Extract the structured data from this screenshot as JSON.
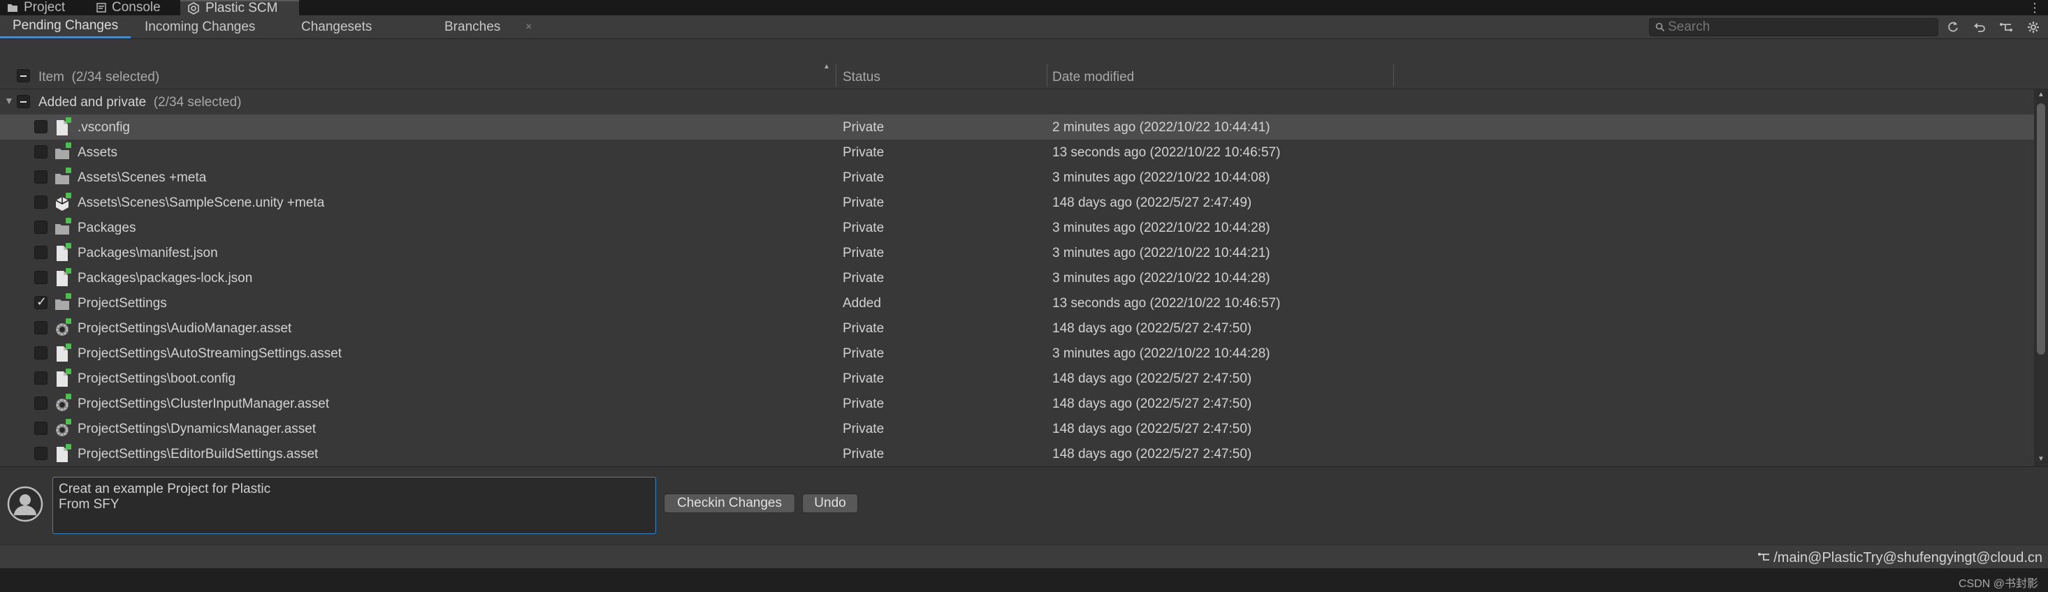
{
  "window_tabs": [
    {
      "label": "Project",
      "icon": "folder-icon"
    },
    {
      "label": "Console",
      "icon": "console-icon"
    },
    {
      "label": "Plastic SCM",
      "icon": "plastic-scm-icon"
    }
  ],
  "toolbar": {
    "tabs": [
      "Pending Changes",
      "Incoming Changes",
      "Changesets",
      "Branches"
    ],
    "active_tab": "Pending Changes",
    "close_glyph": "×",
    "search_placeholder": "Search"
  },
  "columns": {
    "item": "Item",
    "item_count": "(2/34 selected)",
    "status": "Status",
    "date": "Date modified"
  },
  "group": {
    "label": "Added and private",
    "count": "(2/34 selected)"
  },
  "rows": [
    {
      "name": ".vsconfig",
      "icon": "file-icon",
      "status": "Private",
      "date": "2 minutes ago (2022/10/22 10:44:41)",
      "checked": false,
      "selected": true
    },
    {
      "name": "Assets",
      "icon": "folder-icon",
      "status": "Private",
      "date": "13 seconds ago (2022/10/22 10:46:57)",
      "checked": false,
      "selected": false
    },
    {
      "name": "Assets\\Scenes +meta",
      "icon": "folder-icon",
      "status": "Private",
      "date": "3 minutes ago (2022/10/22 10:44:08)",
      "checked": false,
      "selected": false
    },
    {
      "name": "Assets\\Scenes\\SampleScene.unity +meta",
      "icon": "unity-scene-icon",
      "status": "Private",
      "date": "148 days ago (2022/5/27 2:47:49)",
      "checked": false,
      "selected": false
    },
    {
      "name": "Packages",
      "icon": "folder-icon",
      "status": "Private",
      "date": "3 minutes ago (2022/10/22 10:44:28)",
      "checked": false,
      "selected": false
    },
    {
      "name": "Packages\\manifest.json",
      "icon": "file-icon",
      "status": "Private",
      "date": "3 minutes ago (2022/10/22 10:44:21)",
      "checked": false,
      "selected": false
    },
    {
      "name": "Packages\\packages-lock.json",
      "icon": "file-icon",
      "status": "Private",
      "date": "3 minutes ago (2022/10/22 10:44:28)",
      "checked": false,
      "selected": false
    },
    {
      "name": "ProjectSettings",
      "icon": "folder-icon",
      "status": "Added",
      "date": "13 seconds ago (2022/10/22 10:46:57)",
      "checked": true,
      "selected": false
    },
    {
      "name": "ProjectSettings\\AudioManager.asset",
      "icon": "settings-asset-icon",
      "status": "Private",
      "date": "148 days ago (2022/5/27 2:47:50)",
      "checked": false,
      "selected": false
    },
    {
      "name": "ProjectSettings\\AutoStreamingSettings.asset",
      "icon": "file-icon",
      "status": "Private",
      "date": "3 minutes ago (2022/10/22 10:44:28)",
      "checked": false,
      "selected": false
    },
    {
      "name": "ProjectSettings\\boot.config",
      "icon": "file-icon",
      "status": "Private",
      "date": "148 days ago (2022/5/27 2:47:50)",
      "checked": false,
      "selected": false
    },
    {
      "name": "ProjectSettings\\ClusterInputManager.asset",
      "icon": "settings-asset-icon",
      "status": "Private",
      "date": "148 days ago (2022/5/27 2:47:50)",
      "checked": false,
      "selected": false
    },
    {
      "name": "ProjectSettings\\DynamicsManager.asset",
      "icon": "settings-asset-icon",
      "status": "Private",
      "date": "148 days ago (2022/5/27 2:47:50)",
      "checked": false,
      "selected": false
    },
    {
      "name": "ProjectSettings\\EditorBuildSettings.asset",
      "icon": "file-icon",
      "status": "Private",
      "date": "148 days ago (2022/5/27 2:47:50)",
      "checked": false,
      "selected": false
    }
  ],
  "checkin": {
    "comment": "Creat an example Project for Plastic\nFrom SFY",
    "checkin_label": "Checkin Changes",
    "undo_label": "Undo"
  },
  "statusbar": {
    "branch": "/main@PlasticTry@shufengyingt@cloud.cn"
  },
  "watermark": "CSDN @书封影",
  "colors": {
    "accent": "#3f83c5",
    "added_badge": "#4fc04f",
    "selected_row": "#4d4d4d"
  }
}
